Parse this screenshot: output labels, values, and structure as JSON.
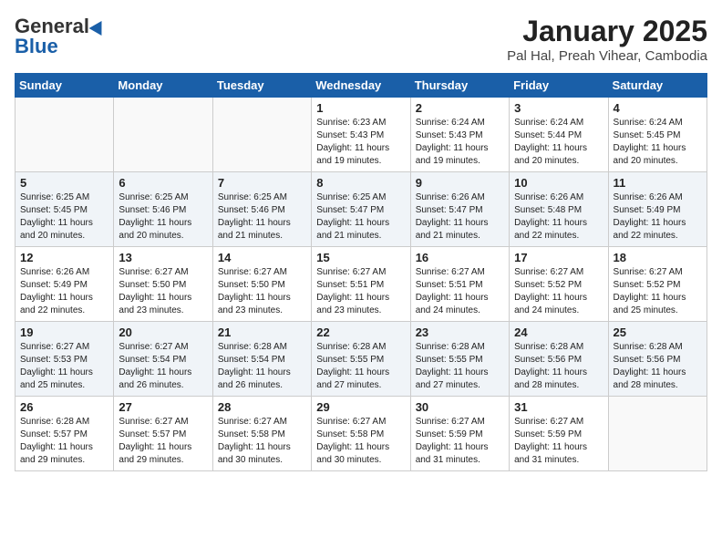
{
  "header": {
    "logo_general": "General",
    "logo_blue": "Blue",
    "month_title": "January 2025",
    "location": "Pal Hal, Preah Vihear, Cambodia"
  },
  "weekdays": [
    "Sunday",
    "Monday",
    "Tuesday",
    "Wednesday",
    "Thursday",
    "Friday",
    "Saturday"
  ],
  "weeks": [
    [
      {
        "day": "",
        "info": ""
      },
      {
        "day": "",
        "info": ""
      },
      {
        "day": "",
        "info": ""
      },
      {
        "day": "1",
        "info": "Sunrise: 6:23 AM\nSunset: 5:43 PM\nDaylight: 11 hours\nand 19 minutes."
      },
      {
        "day": "2",
        "info": "Sunrise: 6:24 AM\nSunset: 5:43 PM\nDaylight: 11 hours\nand 19 minutes."
      },
      {
        "day": "3",
        "info": "Sunrise: 6:24 AM\nSunset: 5:44 PM\nDaylight: 11 hours\nand 20 minutes."
      },
      {
        "day": "4",
        "info": "Sunrise: 6:24 AM\nSunset: 5:45 PM\nDaylight: 11 hours\nand 20 minutes."
      }
    ],
    [
      {
        "day": "5",
        "info": "Sunrise: 6:25 AM\nSunset: 5:45 PM\nDaylight: 11 hours\nand 20 minutes."
      },
      {
        "day": "6",
        "info": "Sunrise: 6:25 AM\nSunset: 5:46 PM\nDaylight: 11 hours\nand 20 minutes."
      },
      {
        "day": "7",
        "info": "Sunrise: 6:25 AM\nSunset: 5:46 PM\nDaylight: 11 hours\nand 21 minutes."
      },
      {
        "day": "8",
        "info": "Sunrise: 6:25 AM\nSunset: 5:47 PM\nDaylight: 11 hours\nand 21 minutes."
      },
      {
        "day": "9",
        "info": "Sunrise: 6:26 AM\nSunset: 5:47 PM\nDaylight: 11 hours\nand 21 minutes."
      },
      {
        "day": "10",
        "info": "Sunrise: 6:26 AM\nSunset: 5:48 PM\nDaylight: 11 hours\nand 22 minutes."
      },
      {
        "day": "11",
        "info": "Sunrise: 6:26 AM\nSunset: 5:49 PM\nDaylight: 11 hours\nand 22 minutes."
      }
    ],
    [
      {
        "day": "12",
        "info": "Sunrise: 6:26 AM\nSunset: 5:49 PM\nDaylight: 11 hours\nand 22 minutes."
      },
      {
        "day": "13",
        "info": "Sunrise: 6:27 AM\nSunset: 5:50 PM\nDaylight: 11 hours\nand 23 minutes."
      },
      {
        "day": "14",
        "info": "Sunrise: 6:27 AM\nSunset: 5:50 PM\nDaylight: 11 hours\nand 23 minutes."
      },
      {
        "day": "15",
        "info": "Sunrise: 6:27 AM\nSunset: 5:51 PM\nDaylight: 11 hours\nand 23 minutes."
      },
      {
        "day": "16",
        "info": "Sunrise: 6:27 AM\nSunset: 5:51 PM\nDaylight: 11 hours\nand 24 minutes."
      },
      {
        "day": "17",
        "info": "Sunrise: 6:27 AM\nSunset: 5:52 PM\nDaylight: 11 hours\nand 24 minutes."
      },
      {
        "day": "18",
        "info": "Sunrise: 6:27 AM\nSunset: 5:52 PM\nDaylight: 11 hours\nand 25 minutes."
      }
    ],
    [
      {
        "day": "19",
        "info": "Sunrise: 6:27 AM\nSunset: 5:53 PM\nDaylight: 11 hours\nand 25 minutes."
      },
      {
        "day": "20",
        "info": "Sunrise: 6:27 AM\nSunset: 5:54 PM\nDaylight: 11 hours\nand 26 minutes."
      },
      {
        "day": "21",
        "info": "Sunrise: 6:28 AM\nSunset: 5:54 PM\nDaylight: 11 hours\nand 26 minutes."
      },
      {
        "day": "22",
        "info": "Sunrise: 6:28 AM\nSunset: 5:55 PM\nDaylight: 11 hours\nand 27 minutes."
      },
      {
        "day": "23",
        "info": "Sunrise: 6:28 AM\nSunset: 5:55 PM\nDaylight: 11 hours\nand 27 minutes."
      },
      {
        "day": "24",
        "info": "Sunrise: 6:28 AM\nSunset: 5:56 PM\nDaylight: 11 hours\nand 28 minutes."
      },
      {
        "day": "25",
        "info": "Sunrise: 6:28 AM\nSunset: 5:56 PM\nDaylight: 11 hours\nand 28 minutes."
      }
    ],
    [
      {
        "day": "26",
        "info": "Sunrise: 6:28 AM\nSunset: 5:57 PM\nDaylight: 11 hours\nand 29 minutes."
      },
      {
        "day": "27",
        "info": "Sunrise: 6:27 AM\nSunset: 5:57 PM\nDaylight: 11 hours\nand 29 minutes."
      },
      {
        "day": "28",
        "info": "Sunrise: 6:27 AM\nSunset: 5:58 PM\nDaylight: 11 hours\nand 30 minutes."
      },
      {
        "day": "29",
        "info": "Sunrise: 6:27 AM\nSunset: 5:58 PM\nDaylight: 11 hours\nand 30 minutes."
      },
      {
        "day": "30",
        "info": "Sunrise: 6:27 AM\nSunset: 5:59 PM\nDaylight: 11 hours\nand 31 minutes."
      },
      {
        "day": "31",
        "info": "Sunrise: 6:27 AM\nSunset: 5:59 PM\nDaylight: 11 hours\nand 31 minutes."
      },
      {
        "day": "",
        "info": ""
      }
    ]
  ]
}
